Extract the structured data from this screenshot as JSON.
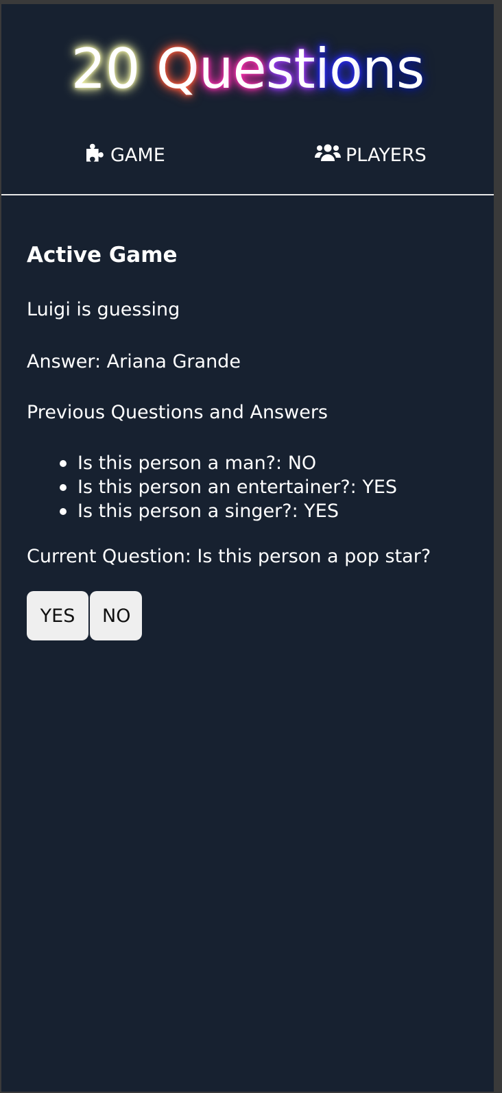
{
  "header": {
    "title": "20 Questions",
    "title_glow_colors": [
      "#f6f7a8",
      "#ff5a3c",
      "#ff2fb0",
      "#a23cff",
      "#2a2aff",
      "#0a1a8a"
    ]
  },
  "nav": {
    "game": {
      "label": "GAME",
      "icon": "puzzle-piece-icon"
    },
    "players": {
      "label": "PLAYERS",
      "icon": "users-icon"
    }
  },
  "game": {
    "heading": "Active Game",
    "guessing_text": "Luigi is guessing",
    "answer_text": "Answer: Ariana Grande",
    "previous_heading": "Previous Questions and Answers",
    "previous": [
      "Is this person a man?: NO",
      "Is this person an entertainer?: YES",
      "Is this person a singer?: YES"
    ],
    "current_question": "Current Question: Is this person a pop star?",
    "yes_label": "YES",
    "no_label": "NO"
  },
  "colors": {
    "background": "#172130",
    "text": "#ffffff",
    "button_bg": "#efefef"
  }
}
